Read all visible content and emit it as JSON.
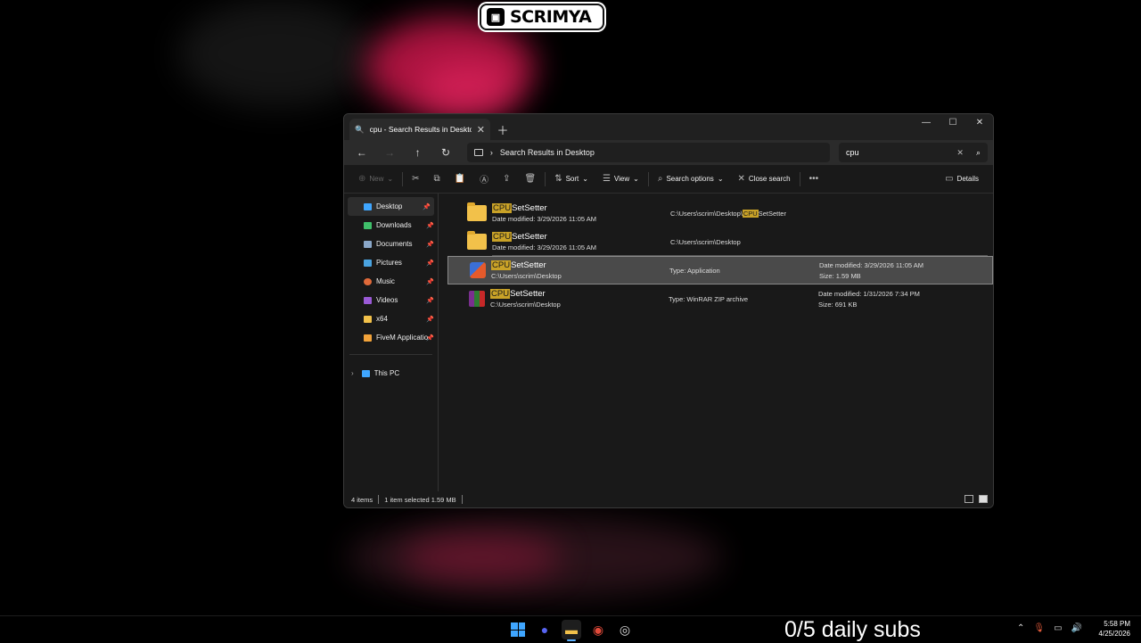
{
  "overlay": {
    "streamer_name": "SCRIMYA",
    "subs_counter": "0/5 daily subs"
  },
  "window": {
    "tab_title": "cpu - Search Results in Desktop",
    "breadcrumb": "Search Results in Desktop",
    "search_value": "cpu"
  },
  "toolbar": {
    "new_label": "New",
    "sort_label": "Sort",
    "view_label": "View",
    "search_options_label": "Search options",
    "close_search_label": "Close search",
    "details_label": "Details"
  },
  "sidebar": {
    "items": [
      {
        "label": "Desktop",
        "icon": "desktop-icon",
        "color": "#3fa6ff"
      },
      {
        "label": "Downloads",
        "icon": "download-icon",
        "color": "#3fbf6a"
      },
      {
        "label": "Documents",
        "icon": "document-icon",
        "color": "#8aa7c8"
      },
      {
        "label": "Pictures",
        "icon": "picture-icon",
        "color": "#4aa3e0"
      },
      {
        "label": "Music",
        "icon": "music-icon",
        "color": "#e06a3a"
      },
      {
        "label": "Videos",
        "icon": "video-icon",
        "color": "#9a5ad6"
      },
      {
        "label": "x64",
        "icon": "folder-icon",
        "color": "#f2c14a"
      },
      {
        "label": "FiveM Application Data",
        "icon": "fivem-icon",
        "color": "#f2a33a"
      }
    ],
    "this_pc": "This PC"
  },
  "files": [
    {
      "name_hl": "CPU",
      "name_rest": "SetSetter",
      "sub": "Date modified: 3/29/2026 11:05 AM",
      "path_pre": "C:\\Users\\scrim\\Desktop\\",
      "path_hl": "CPU",
      "path_post": "SetSetter",
      "meta1": "",
      "meta2": ""
    },
    {
      "name_hl": "CPU",
      "name_rest": "SetSetter",
      "sub": "Date modified: 3/29/2026 11:05 AM",
      "path_pre": "C:\\Users\\scrim\\Desktop",
      "path_hl": "",
      "path_post": "",
      "meta1": "",
      "meta2": ""
    },
    {
      "name_hl": "CPU",
      "name_rest": "SetSetter",
      "sub": "C:\\Users\\scrim\\Desktop",
      "path_pre": "Type: Application",
      "path_hl": "",
      "path_post": "",
      "meta1": "Date modified: 3/29/2026 11:05 AM",
      "meta2": "Size: 1.59 MB"
    },
    {
      "name_hl": "CPU",
      "name_rest": "SetSetter",
      "sub": "C:\\Users\\scrim\\Desktop",
      "path_pre": "Type: WinRAR ZIP archive",
      "path_hl": "",
      "path_post": "",
      "meta1": "Date modified: 1/31/2026 7:34 PM",
      "meta2": "Size: 691 KB"
    }
  ],
  "status": {
    "count": "4 items",
    "selection": "1 item selected  1.59 MB"
  },
  "clock": {
    "time": "5:58 PM",
    "date": "4/25/2026"
  }
}
